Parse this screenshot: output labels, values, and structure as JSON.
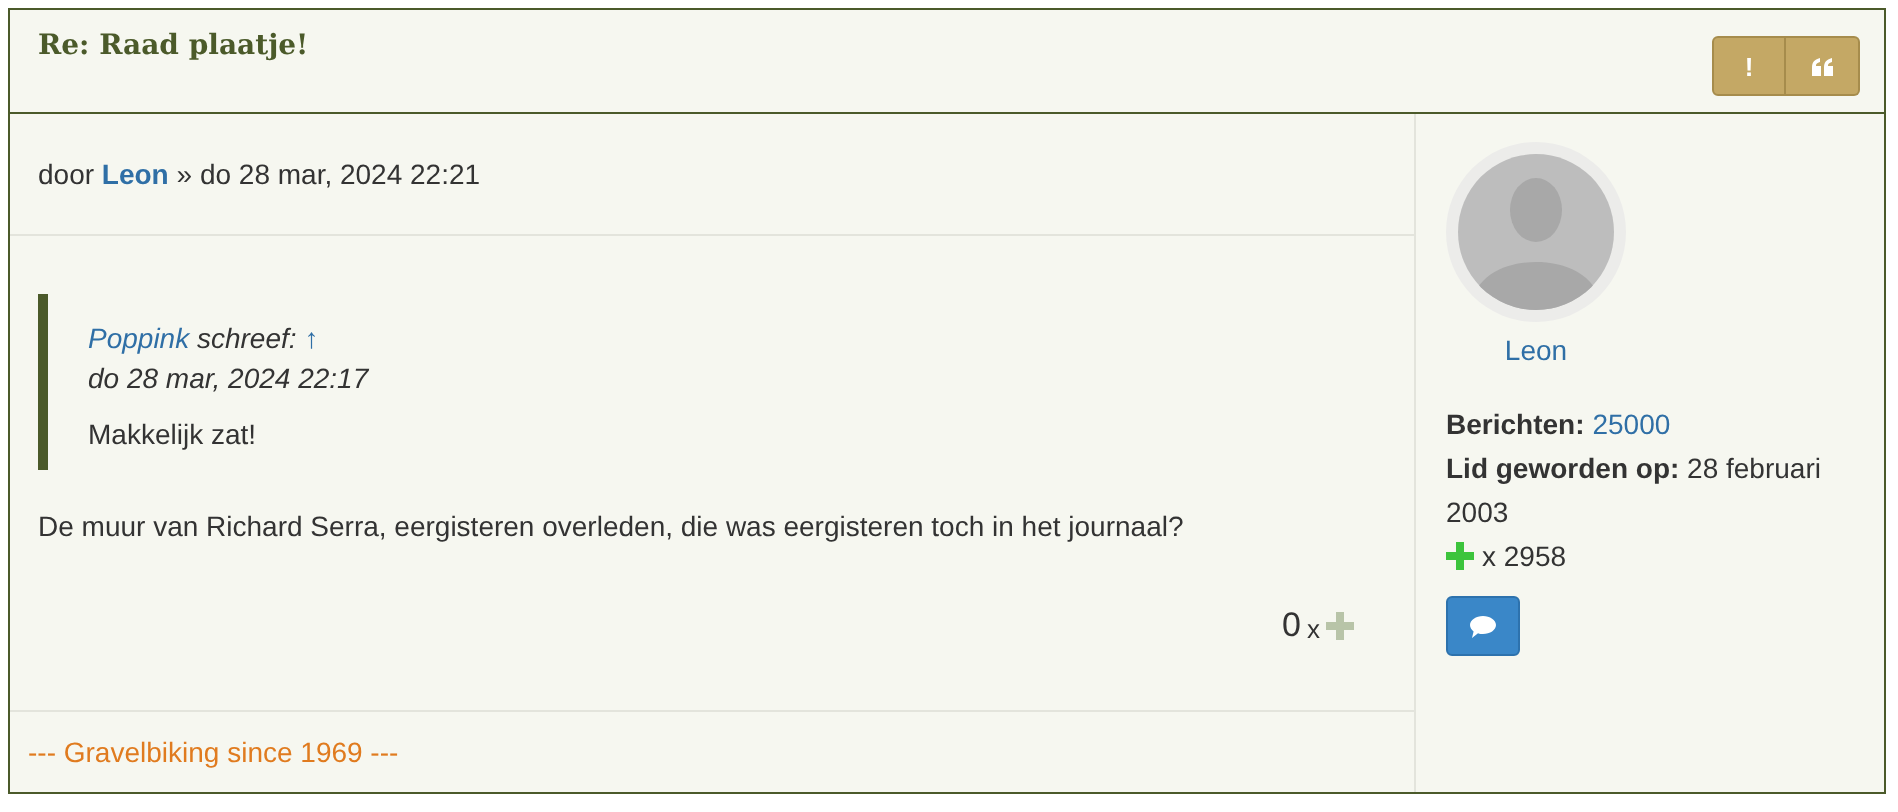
{
  "post": {
    "title": "Re: Raad plaatje!",
    "actions": [
      {
        "kind": "text",
        "label": "!"
      },
      {
        "kind": "quote"
      }
    ],
    "meta": {
      "prefix": "door",
      "author": "Leon",
      "date": "» do 28 mar, 2024 22:21"
    },
    "quote": {
      "author": "Poppink",
      "wrote": "schreef:",
      "jump": "↑",
      "date": "do 28 mar, 2024 22:17",
      "text": "Makkelijk zat!"
    },
    "body": "De muur van Richard Serra, eergisteren overleden, die was eergisteren toch in het journaal?",
    "likes": {
      "count": "0",
      "x": "x"
    },
    "signature": "--- Gravelbiking since 1969 ---"
  },
  "profile": {
    "name": "Leon",
    "posts_label": "Berichten:",
    "posts": "25000",
    "joined": "**Lid geworden op:** 28 februari 2003",
    "thanks": "x 2958"
  }
}
